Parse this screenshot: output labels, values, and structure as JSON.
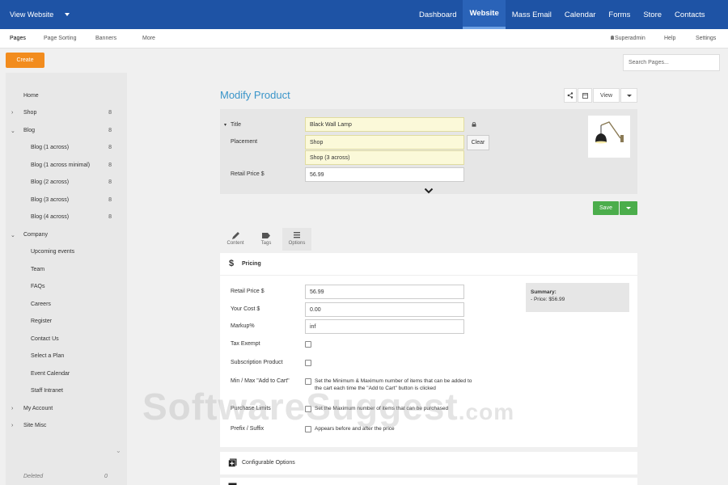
{
  "topbar": {
    "view_website": "View Website",
    "nav": [
      "Dashboard",
      "Website",
      "Mass Email",
      "Calendar",
      "Forms",
      "Store",
      "Contacts"
    ],
    "active": "Website"
  },
  "subnav": {
    "left": [
      "Pages",
      "Page Sorting",
      "Banners",
      "More"
    ],
    "right": [
      "Superadmin",
      "Help",
      "Settings"
    ]
  },
  "create_label": "Create",
  "search_placeholder": "Search Pages...",
  "sidebar": {
    "items": [
      {
        "label": "Home"
      },
      {
        "label": "Shop",
        "count": "8"
      },
      {
        "label": "Blog",
        "count": "8"
      },
      {
        "label": "Blog (1 across)",
        "count": "8"
      },
      {
        "label": "Blog (1 across minimal)",
        "count": "8"
      },
      {
        "label": "Blog (2 across)",
        "count": "8"
      },
      {
        "label": "Blog (3 across)",
        "count": "8"
      },
      {
        "label": "Blog (4 across)",
        "count": "8"
      },
      {
        "label": "Company"
      },
      {
        "label": "Upcoming events"
      },
      {
        "label": "Team"
      },
      {
        "label": "FAQs"
      },
      {
        "label": "Careers"
      },
      {
        "label": "Register"
      },
      {
        "label": "Contact Us"
      },
      {
        "label": "Select a Plan"
      },
      {
        "label": "Event Calendar"
      },
      {
        "label": "Staff Intranet"
      },
      {
        "label": "My Account"
      },
      {
        "label": "Site Misc"
      }
    ],
    "deleted_label": "Deleted",
    "deleted_count": "0"
  },
  "page_title": "Modify Product",
  "view_label": "View",
  "form": {
    "title_label": "Title",
    "title_value": "Black Wall Lamp",
    "placement_label": "Placement",
    "placement_value": "Shop",
    "placement_sub": "Shop (3 across)",
    "clear_label": "Clear",
    "retail_label": "Retail Price $",
    "retail_value": "56.99"
  },
  "save_label": "Save",
  "tabs": [
    "Content",
    "Tags",
    "Options"
  ],
  "pricing": {
    "title": "Pricing",
    "retail_label": "Retail Price $",
    "retail_value": "56.99",
    "cost_label": "Your Cost $",
    "cost_value": "0.00",
    "markup_label": "Markup%",
    "markup_value": "inf",
    "tax_label": "Tax Exempt",
    "subscription_label": "Subscription Product",
    "minmax_label": "Min / Max \"Add to Cart\"",
    "minmax_text": "Set the Minimum & Maximum number of items that can be added to the cart each time the \"Add to Cart\" button is clicked",
    "purchase_label": "Purchase Limits",
    "purchase_text": "Set the Maximum number of items that can be purchased",
    "prefix_label": "Prefix / Suffix",
    "prefix_text": "Appears before and after the price",
    "summary_title": "Summary:",
    "summary_line": "- Price: $56.99"
  },
  "configurable_label": "Configurable Options",
  "watermark": "SoftwareSuggest",
  "watermark_suffix": ".com"
}
